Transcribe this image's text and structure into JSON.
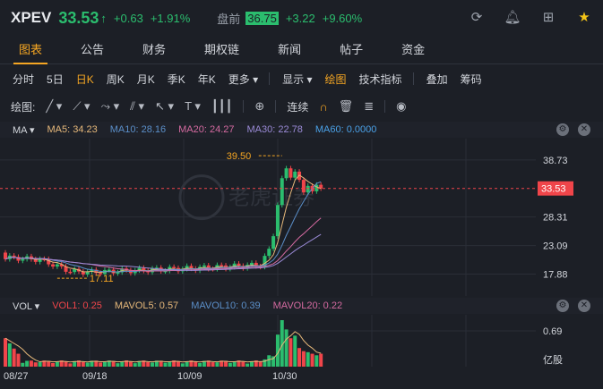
{
  "header": {
    "ticker": "XPEV",
    "price": "33.53",
    "change": "+0.63",
    "change_pct": "+1.91%",
    "pm_label": "盘前",
    "pm_price": "36.75",
    "pm_change": "+3.22",
    "pm_change_pct": "+9.60%",
    "icons": [
      "refresh-icon",
      "bell-icon",
      "grid-icon",
      "star-icon"
    ]
  },
  "tabs": [
    "图表",
    "公告",
    "财务",
    "期权链",
    "新闻",
    "帖子",
    "资金"
  ],
  "periods": [
    "分时",
    "5日",
    "日K",
    "周K",
    "月K",
    "季K",
    "年K",
    "更多"
  ],
  "period_tools": [
    "显示",
    "绘图",
    "技术指标",
    "叠加",
    "筹码"
  ],
  "draw_label": "绘图:",
  "draw_link": "连续",
  "ma_legend": {
    "label": "MA",
    "ma5": "MA5: 34.23",
    "ma10": "MA10: 28.16",
    "ma20": "MA20: 24.27",
    "ma30": "MA30: 22.78",
    "ma60": "MA60: 0.0000"
  },
  "vol_legend": {
    "label": "VOL",
    "vol1": "VOL1: 0.25",
    "mavol5": "MAVOL5: 0.57",
    "mavol10": "MAVOL10: 0.39",
    "mavol20": "MAVOL20: 0.22"
  },
  "colors": {
    "up": "#2bbd6e",
    "down": "#f0454a",
    "accent": "#f5a623",
    "ma5": "#e6b87a",
    "ma10": "#5b8fc9",
    "ma20": "#d46aa0",
    "ma30": "#9a8ad6",
    "ma60": "#4aa0e6"
  },
  "watermark": "老虎证券",
  "chart_data": {
    "type": "candlestick",
    "price_axis_ticks": [
      "38.73",
      "33.53",
      "28.31",
      "23.09",
      "17.88"
    ],
    "current_price": "33.53",
    "annotations": {
      "high": "39.50",
      "low": "17.11"
    },
    "volume_axis_ticks": [
      "0.69",
      "亿股"
    ],
    "x_ticks": [
      "08/27",
      "09/18",
      "10/09",
      "10/30"
    ],
    "ylim": [
      15.5,
      41
    ]
  }
}
